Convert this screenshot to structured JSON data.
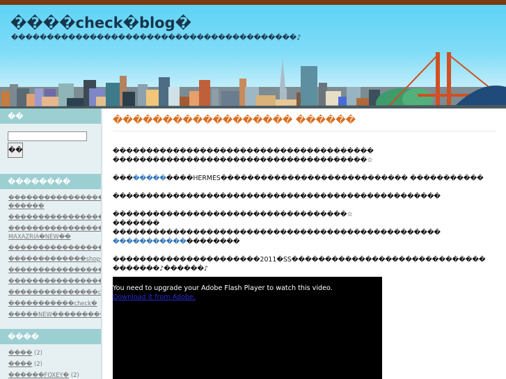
{
  "site": {
    "title": "����check�blog�",
    "description": "����������������������������������������♪"
  },
  "sidebar": {
    "search_heading": "��",
    "search_button": "��",
    "recent_heading": "��������",
    "recent_posts": [
      "������������������ ������",
      "�����������������������������",
      "���������������������BCBG MAXAZRIA�NEW��",
      "���������������������bv������FOXEY�",
      "�������������shop���������",
      "����������������������������������",
      "������������������������������",
      "���������������check�",
      "�����������check�",
      "�����NEW����������check�"
    ],
    "archives_heading": "����",
    "archives": [
      {
        "label": "����",
        "count": "(2)"
      },
      {
        "label": "����",
        "count": "(2)"
      },
      {
        "label": "������FOXEY�",
        "count": "(2)"
      }
    ]
  },
  "post": {
    "title": "������������������ ������",
    "p1_line1": "���������������������������������������",
    "p1_line2": "��������������������������������������☆",
    "p2_before": "���",
    "p2_link": "�����",
    "p2_after": "����HERMES���������������������������� �����������",
    "p3": "�������������������������������������������������",
    "p4_line1": "�����������������������������������☆",
    "p4_line2": "�������",
    "p4_line3": "�������������������������������������������������",
    "p4_link": "�����������",
    "p4_after_link": "��������",
    "p5_line1": "����������������������2011�SS�����������������������������",
    "p5_line2": "�������♪������♪"
  },
  "flash": {
    "message": "You need to upgrade your Adobe Flash Player to watch this video.",
    "link": "Download it from Adobe."
  },
  "colors": {
    "top_bar": "#7a3a12",
    "sky": "#5fd3f6",
    "title_text": "#17344a",
    "sidebar_bg": "#e6f0f3",
    "sidebar_heading_bg": "#9ccfd2",
    "post_title": "#d96d1e",
    "link": "#2a72b8"
  },
  "icons": {
    "header_art": "city-skyline-illustration"
  }
}
